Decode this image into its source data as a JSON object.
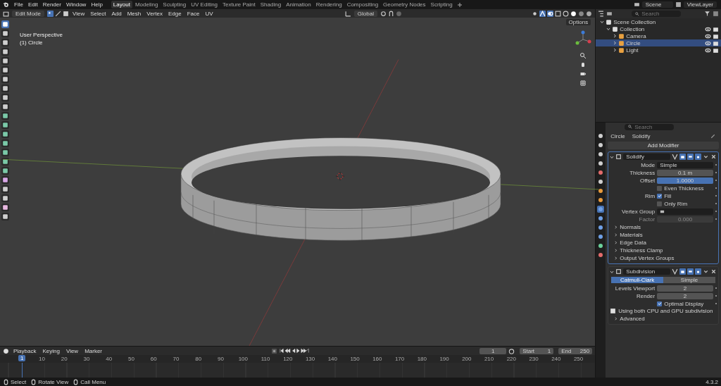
{
  "menu": [
    "File",
    "Edit",
    "Render",
    "Window",
    "Help"
  ],
  "workspaces": [
    {
      "label": "Layout",
      "selected": true
    },
    {
      "label": "Modeling",
      "selected": false
    },
    {
      "label": "Sculpting",
      "selected": false
    },
    {
      "label": "UV Editing",
      "selected": false
    },
    {
      "label": "Texture Paint",
      "selected": false
    },
    {
      "label": "Shading",
      "selected": false
    },
    {
      "label": "Animation",
      "selected": false
    },
    {
      "label": "Rendering",
      "selected": false
    },
    {
      "label": "Compositing",
      "selected": false
    },
    {
      "label": "Geometry Nodes",
      "selected": false
    },
    {
      "label": "Scripting",
      "selected": false
    }
  ],
  "scene": "Scene",
  "view_layer": "ViewLayer",
  "header": {
    "mode": "Edit Mode",
    "menus": [
      "View",
      "Select",
      "Add",
      "Mesh",
      "Vertex",
      "Edge",
      "Face",
      "UV"
    ],
    "transform": "Global",
    "options": "Options"
  },
  "toolbar": [
    {
      "selected": true
    },
    {
      "selected": false
    },
    {
      "selected": false
    },
    {
      "selected": false
    },
    {
      "selected": false
    },
    {
      "selected": false
    },
    {
      "selected": false
    },
    {
      "selected": false
    },
    {
      "selected": false
    },
    {
      "selected": false
    },
    {
      "selected": false
    },
    {
      "selected": false
    },
    {
      "selected": false
    },
    {
      "selected": false
    },
    {
      "selected": false
    },
    {
      "selected": false
    },
    {
      "selected": false
    },
    {
      "selected": false
    },
    {
      "selected": false
    },
    {
      "selected": false
    },
    {
      "selected": false
    },
    {
      "selected": false
    }
  ],
  "viewport": {
    "title": "User Perspective",
    "object": "(1) Circle"
  },
  "outliner": {
    "search_placeholder": "Search",
    "tree": [
      {
        "label": "Scene Collection",
        "expanded": true,
        "selected": false,
        "children": [
          {
            "label": "Collection",
            "expanded": true,
            "selected": false,
            "children": [
              {
                "label": "Camera",
                "expanded": false,
                "selected": false
              },
              {
                "label": "Circle",
                "expanded": false,
                "selected": true
              },
              {
                "label": "Light",
                "expanded": false,
                "selected": false
              }
            ]
          }
        ]
      }
    ]
  },
  "property_tabs": [
    {
      "selected": false
    },
    {
      "selected": false
    },
    {
      "selected": false
    },
    {
      "selected": false
    },
    {
      "selected": false
    },
    {
      "selected": false
    },
    {
      "selected": false
    },
    {
      "selected": false
    },
    {
      "selected": true
    },
    {
      "selected": false
    },
    {
      "selected": false
    },
    {
      "selected": false
    },
    {
      "selected": false
    },
    {
      "selected": false
    }
  ],
  "properties": {
    "search_placeholder": "Search",
    "breadcrumb": [
      "Circle",
      "Solidify"
    ],
    "add_modifier": "Add Modifier",
    "modifiers": [
      {
        "name": "Solidify",
        "fields": [
          {
            "kind": "dropdown",
            "label": "Mode",
            "value": "Simple",
            "disabled": false
          },
          {
            "kind": "number",
            "label": "Thickness",
            "value": "0.1 m",
            "disabled": false
          },
          {
            "kind": "slider",
            "label": "Offset",
            "value": "1.0000",
            "level": 1,
            "disabled": false
          },
          {
            "kind": "checkbox",
            "label": "Even Thickness",
            "checked": false,
            "disabled": false
          },
          {
            "kind": "checkbox",
            "group": "Rim",
            "label": "Fill",
            "checked": true,
            "disabled": false
          },
          {
            "kind": "checkbox",
            "label": "Only Rim",
            "checked": false,
            "disabled": false
          },
          {
            "kind": "field",
            "label": "Vertex Group",
            "disabled": false
          },
          {
            "kind": "number",
            "label": "Factor",
            "value": "0.000",
            "disabled": true
          }
        ],
        "panels": [
          "Normals",
          "Materials",
          "Edge Data",
          "Thickness Clamp",
          "Output Vertex Groups"
        ]
      },
      {
        "name": "Subdivision",
        "tabs": [
          {
            "label": "Catmull-Clark",
            "selected": true
          },
          {
            "label": "Simple",
            "selected": false
          }
        ],
        "fields": [
          {
            "kind": "number",
            "label": "Levels Viewport",
            "value": "2",
            "disabled": false
          },
          {
            "kind": "number",
            "label": "Render",
            "value": "2",
            "disabled": false
          },
          {
            "kind": "checkbox",
            "label": "Optimal Display",
            "checked": true,
            "disabled": false
          }
        ],
        "info": "Using both CPU and GPU subdivision",
        "panels": [
          "Advanced"
        ]
      }
    ]
  },
  "timeline": {
    "menus": [
      "Playback",
      "Keying",
      "View",
      "Marker"
    ],
    "frame": "1",
    "start_label": "Start",
    "start": "1",
    "end_label": "End",
    "end": "250",
    "current": "1",
    "ticks": [
      "10",
      "20",
      "30",
      "40",
      "50",
      "60",
      "70",
      "80",
      "90",
      "100",
      "110",
      "120",
      "130",
      "140",
      "150",
      "160",
      "170",
      "180",
      "190",
      "200",
      "210",
      "220",
      "230",
      "240",
      "250"
    ]
  },
  "status_bar": {
    "hints": [
      "Select",
      "Rotate View",
      "Call Menu"
    ],
    "version": "4.3.2"
  }
}
